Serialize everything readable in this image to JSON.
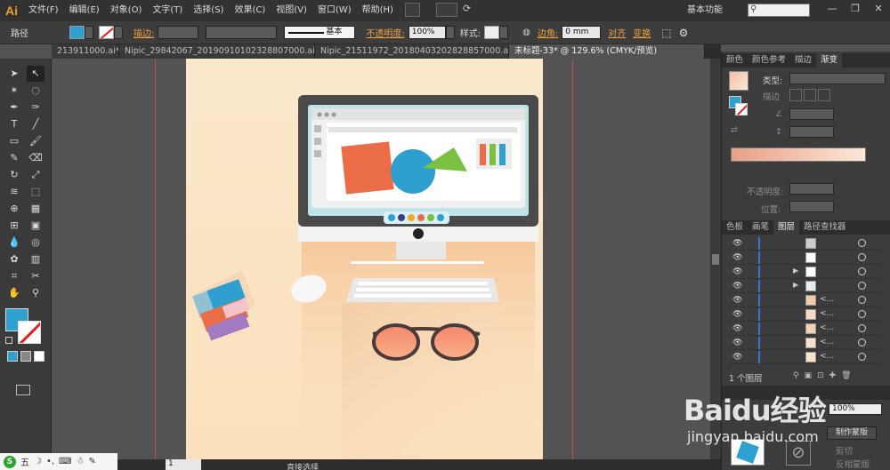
{
  "app": {
    "logo": "Ai"
  },
  "menu": [
    "文件(F)",
    "编辑(E)",
    "对象(O)",
    "文字(T)",
    "选择(S)",
    "效果(C)",
    "视图(V)",
    "窗口(W)",
    "帮助(H)"
  ],
  "workspace": "基本功能",
  "search": {
    "placeholder": ""
  },
  "window_controls": [
    "—",
    "❐",
    "✕"
  ],
  "control_bar": {
    "selection_label": "路径",
    "stroke_label": "描边:",
    "stroke_style": "基本",
    "opacity_label": "不透明度:",
    "opacity_value": "100%",
    "style_label": "样式:",
    "corner_label": "边角:",
    "corner_value": "0 mm",
    "align_label": "对齐",
    "transform_label": "变换",
    "fill_color": "#2ea1d0"
  },
  "tabs": [
    {
      "label": "213911000.ai*",
      "active": false
    },
    {
      "label": "Nipic_29842067_20190910102328807000.ai*",
      "active": false
    },
    {
      "label": "Nipic_21511972_20180403202828857000.ai*",
      "active": false
    },
    {
      "label": "未标题-33* @ 129.6% (CMYK/预览)",
      "active": true
    }
  ],
  "gradient_panel": {
    "tabs": [
      "颜色",
      "颜色参考",
      "描边",
      "渐变"
    ],
    "type_label": "类型:",
    "stroke_label": "描边",
    "opacity_label": "不透明度:",
    "position_label": "位置:"
  },
  "layers_panel": {
    "tabs": [
      "色板",
      "画笔",
      "图层",
      "路径查找器"
    ],
    "rows": [
      {
        "name": "",
        "expand": false,
        "thumb": "#cccccc"
      },
      {
        "name": "",
        "expand": false,
        "thumb": "#ffffff"
      },
      {
        "name": "",
        "expand": true,
        "thumb": "#ffffff"
      },
      {
        "name": "",
        "expand": true,
        "thumb": "#e8efe8"
      },
      {
        "name": "<...",
        "expand": false,
        "thumb": "#f5c8a8"
      },
      {
        "name": "<...",
        "expand": false,
        "thumb": "#f8d8c0"
      },
      {
        "name": "<...",
        "expand": false,
        "thumb": "#f6d0b0"
      },
      {
        "name": "<...",
        "expand": false,
        "thumb": "#fae0c8"
      },
      {
        "name": "<...",
        "expand": false,
        "thumb": "#fbe4c8"
      }
    ],
    "count_label": "1 个图层"
  },
  "transparency_panel": {
    "opacity_value": "100%",
    "make_mask": "制作蒙版",
    "clip": "剪切",
    "invert": "反相蒙版"
  },
  "status": {
    "tool": "直接选择",
    "page": "1"
  },
  "ime": {
    "logo": "S",
    "label": "五"
  },
  "watermark": {
    "main": "Baidu经验",
    "sub": "jingyan.baidu.com"
  }
}
